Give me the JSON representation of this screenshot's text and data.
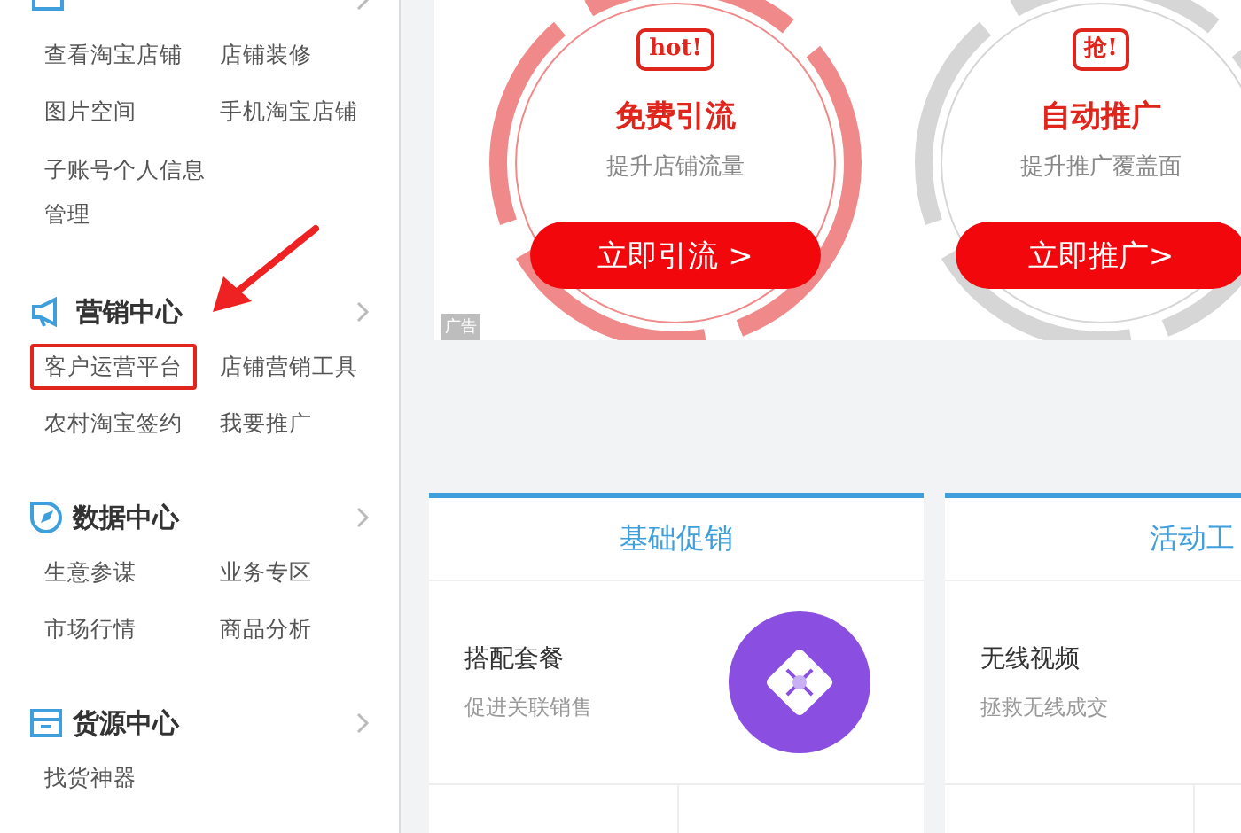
{
  "sidebar": {
    "sections": [
      {
        "kind": "store",
        "items": [
          {
            "label": "查看淘宝店铺",
            "highlighted": false
          },
          {
            "label": "店铺装修",
            "highlighted": false
          },
          {
            "label": "图片空间",
            "highlighted": false
          },
          {
            "label": "手机淘宝店铺",
            "highlighted": false
          },
          {
            "label": "子账号个人信息管理",
            "highlighted": false
          }
        ]
      },
      {
        "kind": "marketing",
        "title": "营销中心",
        "items": [
          {
            "label": "客户运营平台",
            "highlighted": true
          },
          {
            "label": "店铺营销工具",
            "highlighted": false
          },
          {
            "label": "农村淘宝签约",
            "highlighted": false
          },
          {
            "label": "我要推广",
            "highlighted": false
          }
        ]
      },
      {
        "kind": "data",
        "title": "数据中心",
        "items": [
          {
            "label": "生意参谋",
            "highlighted": false
          },
          {
            "label": "业务专区",
            "highlighted": false
          },
          {
            "label": "市场行情",
            "highlighted": false
          },
          {
            "label": "商品分析",
            "highlighted": false
          }
        ]
      },
      {
        "kind": "supply",
        "title": "货源中心",
        "items": [
          {
            "label": "找货神器",
            "highlighted": false
          }
        ]
      }
    ]
  },
  "banner": {
    "promos": [
      {
        "badge": "hot!",
        "title": "免费引流",
        "subtitle": "提升店铺流量",
        "button": "立即引流 >",
        "color": "#f08a8a"
      },
      {
        "badge": "抢!",
        "title": "自动推广",
        "subtitle": "提升推广覆盖面",
        "button": "立即推广>",
        "color": "#d6d6d6"
      }
    ],
    "ad_label": "广告"
  },
  "cards": [
    {
      "title": "基础促销",
      "item": {
        "title": "搭配套餐",
        "subtitle": "促进关联销售",
        "icon": true
      }
    },
    {
      "title": "活动工",
      "item": {
        "title": "无线视频",
        "subtitle": "拯救无线成交"
      }
    }
  ]
}
